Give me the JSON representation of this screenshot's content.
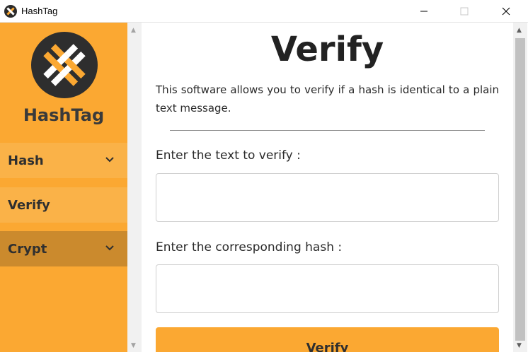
{
  "window": {
    "title": "HashTag",
    "icons": {
      "app": "hashtag-logo-icon",
      "minimize": "minimize-icon",
      "maximize": "maximize-icon",
      "close": "close-icon"
    }
  },
  "sidebar": {
    "brand": "HashTag",
    "logo_icon": "hashtag-logo-icon",
    "items": [
      {
        "label": "Hash",
        "icon": "chevron-down-icon"
      },
      {
        "label": "Verify"
      },
      {
        "label": "Crypt",
        "icon": "chevron-down-icon"
      }
    ]
  },
  "main": {
    "title": "Verify",
    "description": "This software allows you to verify if a hash is identical to a plain text message.",
    "text_label": "Enter the text to verify :",
    "text_value": "",
    "hash_label": "Enter the corresponding hash :",
    "hash_value": "",
    "verify_button": "Verify"
  },
  "colors": {
    "accent": "#fba832",
    "sidebar_item": "#fab248",
    "sidebar_item_active": "#cb8a2d",
    "logo_dark": "#2e2e2e"
  }
}
